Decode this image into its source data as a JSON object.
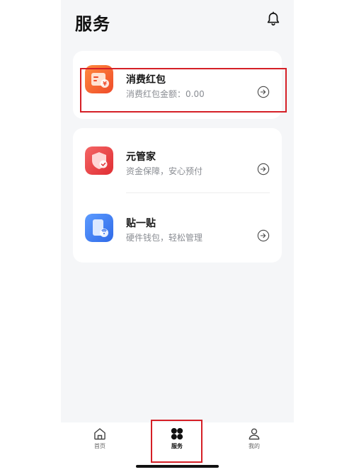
{
  "header": {
    "title": "服务",
    "bell_icon": "bell-icon"
  },
  "services": {
    "red_packet": {
      "title": "消费红包",
      "subtitle": "消费红包金额：0.00",
      "icon": "red-packet-icon",
      "icon_color": "#f2642e"
    },
    "guardian": {
      "title": "元管家",
      "subtitle": "资金保障，安心预付",
      "icon": "shield-check-icon",
      "icon_color": "#ec3f3f"
    },
    "tap_pay": {
      "title": "贴一贴",
      "subtitle": "硬件钱包，轻松管理",
      "icon": "nfc-card-icon",
      "icon_color": "#3e7ef0"
    }
  },
  "tabbar": {
    "home": "首页",
    "services": "服务",
    "mine": "我的",
    "active": "services"
  },
  "colors": {
    "highlight": "#d51f26",
    "background": "#f5f6f8"
  }
}
